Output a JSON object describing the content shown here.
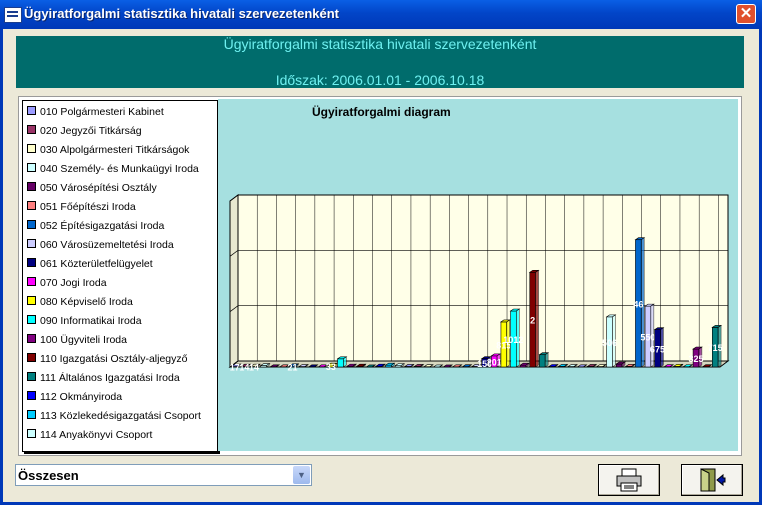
{
  "window": {
    "title": "Ügyiratforgalmi statisztika hivatali szervezetenként"
  },
  "header": {
    "title": "Ügyiratforgalmi statisztika hivatali szervezetenként",
    "period": "Időszak: 2006.01.01 - 2006.10.18"
  },
  "legend": {
    "items": [
      {
        "label": "010 Polgármesteri Kabinet",
        "color": "#9b9bff"
      },
      {
        "label": "020 Jegyzői Titkárság",
        "color": "#993366"
      },
      {
        "label": "030 Alpolgármesteri Titkárságok",
        "color": "#ffffcc"
      },
      {
        "label": "040 Személy- és Munkaügyi Iroda",
        "color": "#ccffff"
      },
      {
        "label": "050 Városépítési Osztály",
        "color": "#660066"
      },
      {
        "label": "051 Főépítészi Iroda",
        "color": "#ff8080"
      },
      {
        "label": "052 Építésigazgatási Iroda",
        "color": "#0066cc"
      },
      {
        "label": "060 Városüzemeltetési Iroda",
        "color": "#ccccff"
      },
      {
        "label": "061 Közterületfelügyelet",
        "color": "#000080"
      },
      {
        "label": "070 Jogi Iroda",
        "color": "#ff00ff"
      },
      {
        "label": "080 Képviselő Iroda",
        "color": "#ffff00"
      },
      {
        "label": "090 Informatikai Iroda",
        "color": "#00ffff"
      },
      {
        "label": "100 Ügyviteli Iroda",
        "color": "#800080"
      },
      {
        "label": "110 Igazgatási Osztály-aljegyző",
        "color": "#800000"
      },
      {
        "label": "111 Általános Igazgatási Iroda",
        "color": "#008080"
      },
      {
        "label": "112 Okmányiroda",
        "color": "#0000ff"
      },
      {
        "label": "113 Közlekedésigazgatási Csoport",
        "color": "#00ccff"
      },
      {
        "label": "114 Anyakönyvi Csoport",
        "color": "#ccffff"
      }
    ]
  },
  "chart_data": {
    "type": "bar",
    "title": "Ügyiratforgalmi diagram",
    "values": [
      17,
      14,
      14,
      26,
      4,
      3,
      21,
      8,
      3,
      3,
      33,
      148,
      16,
      14,
      2,
      14,
      33,
      25,
      10,
      11,
      5,
      2,
      1,
      4,
      5,
      10,
      150,
      201,
      815,
      1012,
      32,
      1712,
      222,
      9,
      11,
      8,
      4,
      10,
      8,
      906,
      54,
      12,
      2300,
      1100,
      675,
      5,
      13,
      7,
      325,
      5,
      715
    ],
    "labels": [
      "17",
      "14",
      "14",
      "",
      "",
      "",
      "21",
      "",
      "",
      "",
      "33",
      "",
      "",
      "",
      "",
      "",
      "",
      "",
      "",
      "",
      "",
      "",
      "",
      "",
      "",
      "",
      "150",
      "201",
      "815",
      "1012",
      "",
      "2",
      "",
      "",
      "",
      "",
      "",
      "",
      "",
      "506",
      "",
      "",
      "46",
      "550",
      "675",
      "",
      "",
      "",
      "325",
      "",
      "715"
    ],
    "ylim": [
      0,
      3000
    ],
    "grid": true,
    "legend": "left"
  },
  "controls": {
    "combo_value": "Összesen"
  },
  "buttons": {
    "print": "print-icon",
    "exit": "exit-door-icon"
  }
}
